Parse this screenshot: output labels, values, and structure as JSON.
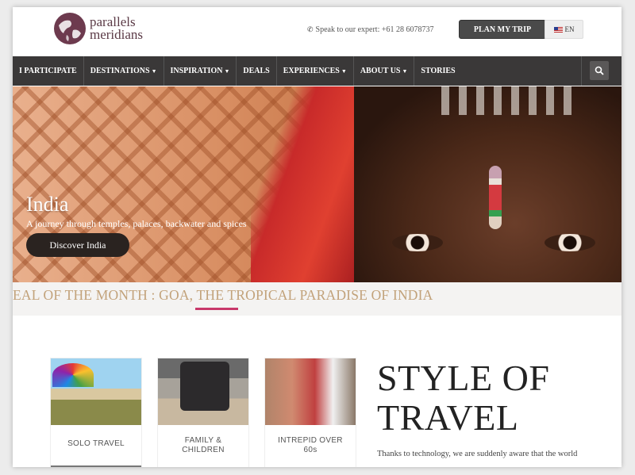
{
  "header": {
    "logo_line1": "parallels",
    "logo_line2": "meridians",
    "expert_text": "Speak to our expert: +61 28 6078737",
    "plan_button": "PLAN MY TRIP",
    "lang_button": "EN"
  },
  "nav": {
    "items": [
      {
        "label": "I PARTICIPATE",
        "dropdown": false
      },
      {
        "label": "DESTINATIONS",
        "dropdown": true
      },
      {
        "label": "INSPIRATION",
        "dropdown": true
      },
      {
        "label": "DEALS",
        "dropdown": false
      },
      {
        "label": "EXPERIENCES",
        "dropdown": true
      },
      {
        "label": "ABOUT US",
        "dropdown": true
      },
      {
        "label": "STORIES",
        "dropdown": false
      }
    ],
    "search_icon": "search-icon"
  },
  "hero": {
    "title": "India",
    "subtitle": "A journey through temples, palaces, backwater and spices",
    "button": "Discover India"
  },
  "deal": {
    "text": "EAL OF THE MONTH : GOA, THE TROPICAL PARADISE OF INDIA"
  },
  "cards": [
    {
      "label": "SOLO TRAVEL"
    },
    {
      "label": "FAMILY &\nCHILDREN"
    },
    {
      "label": "INTREPID OVER\n60s"
    }
  ],
  "style_section": {
    "title_line1": "STYLE OF",
    "title_line2": "TRAVEL",
    "body": "Thanks to technology, we are suddenly aware that the world"
  },
  "colors": {
    "nav_bg": "#3a3838",
    "deal_text": "#c2a27a",
    "deal_accent": "#c8386a",
    "brand": "#5b3a46"
  }
}
